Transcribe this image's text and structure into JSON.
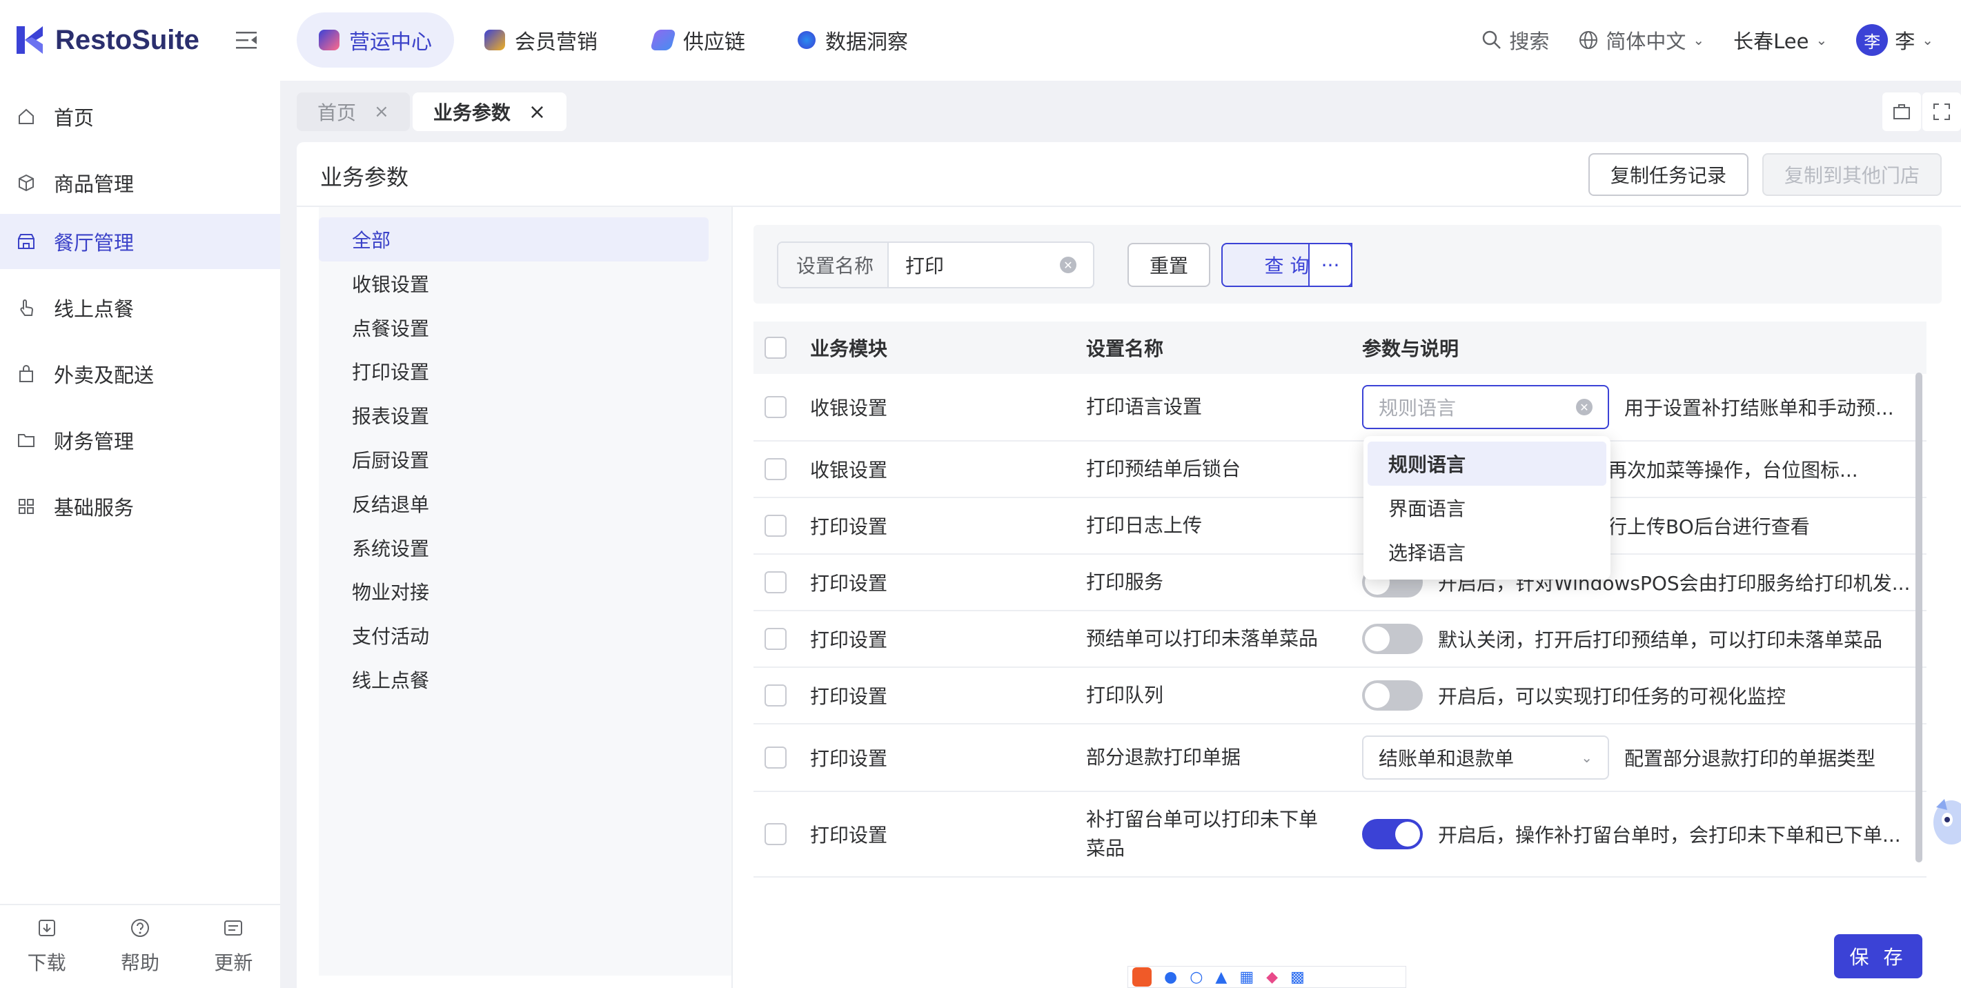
{
  "app": {
    "brand": "RestoSuite"
  },
  "topnav": {
    "tabs": [
      {
        "label": "营运中心",
        "color": "#3b42c8"
      },
      {
        "label": "会员营销",
        "color": "#f0b020"
      },
      {
        "label": "供应链",
        "color": "#8a6cf0"
      },
      {
        "label": "数据洞察",
        "color": "#2a8cf0"
      }
    ],
    "search": "搜索",
    "language": "简体中文",
    "store": "长春Lee",
    "avatar_text": "李",
    "user_name": "李"
  },
  "sidebar": {
    "items": [
      {
        "label": "首页"
      },
      {
        "label": "商品管理"
      },
      {
        "label": "餐厅管理"
      },
      {
        "label": "线上点餐"
      },
      {
        "label": "外卖及配送"
      },
      {
        "label": "财务管理"
      },
      {
        "label": "基础服务"
      }
    ],
    "bottom": [
      {
        "label": "下载"
      },
      {
        "label": "帮助"
      },
      {
        "label": "更新"
      }
    ]
  },
  "page_tabs": [
    {
      "label": "首页"
    },
    {
      "label": "业务参数"
    }
  ],
  "panel": {
    "title": "业务参数",
    "copy_record_btn": "复制任务记录",
    "copy_to_stores_btn": "复制到其他门店"
  },
  "categories": [
    "全部",
    "收银设置",
    "点餐设置",
    "打印设置",
    "报表设置",
    "后厨设置",
    "反结退单",
    "系统设置",
    "物业对接",
    "支付活动",
    "线上点餐"
  ],
  "filter": {
    "field_label": "设置名称",
    "field_value": "打印",
    "reset": "重置",
    "query": "查 询",
    "more": "···"
  },
  "table": {
    "headers": {
      "module": "业务模块",
      "name": "设置名称",
      "param": "参数与说明"
    },
    "rows": [
      {
        "module": "收银设置",
        "name": "打印语言设置",
        "desc": "用于设置补打结账单和手动预..."
      },
      {
        "module": "收银设置",
        "name": "打印预结单后锁台",
        "desc": "允许再次加菜等操作，台位图标..."
      },
      {
        "module": "打印设置",
        "name": "打印日志上传",
        "desc": "务进行上传BO后台进行查看"
      },
      {
        "module": "打印设置",
        "name": "打印服务",
        "desc": "开启后，针对WindowsPOS会由打印服务给打印机发..."
      },
      {
        "module": "打印设置",
        "name": "预结单可以打印未落单菜品",
        "desc": "默认关闭，打开后打印预结单，可以打印未落单菜品"
      },
      {
        "module": "打印设置",
        "name": "打印队列",
        "desc": "开启后，可以实现打印任务的可视化监控"
      },
      {
        "module": "打印设置",
        "name": "部分退款打印单据",
        "select_value": "结账单和退款单",
        "desc": "配置部分退款打印的单据类型"
      },
      {
        "module": "打印设置",
        "name": "补打留台单可以打印未下单菜品",
        "desc": "开启后，操作补打留台单时，会打印未下单和已下单..."
      }
    ],
    "language_select_placeholder": "规则语言"
  },
  "language_dropdown": {
    "options": [
      "规则语言",
      "界面语言",
      "选择语言"
    ],
    "selected": "规则语言"
  },
  "save_button": "保 存",
  "colors": {
    "accent": "#3b42d6",
    "accent_light": "#eceefb"
  }
}
